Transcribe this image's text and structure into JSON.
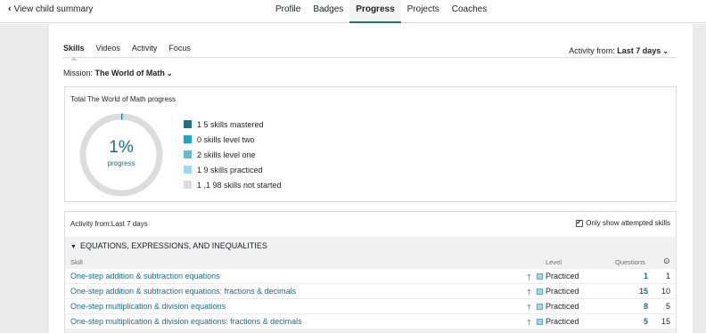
{
  "header": {
    "back_label": "View child summary",
    "tabs": [
      {
        "label": "Profile"
      },
      {
        "label": "Badges"
      },
      {
        "label": "Progress"
      },
      {
        "label": "Projects"
      },
      {
        "label": "Coaches"
      }
    ],
    "active_tab": "Progress"
  },
  "subtabs": {
    "items": [
      {
        "label": "Skills"
      },
      {
        "label": "Videos"
      },
      {
        "label": "Activity"
      },
      {
        "label": "Focus"
      }
    ],
    "active": "Skills",
    "activity_from_label": "Activity from:",
    "activity_from_value": "Last 7 days"
  },
  "mission": {
    "label": "Mission:",
    "value": "The World of Math"
  },
  "progress_card": {
    "title": "Total The World of Math progress",
    "percent_label": "1%",
    "progress_word": "progress",
    "percent_value": 0.01,
    "legend": [
      {
        "label": "1 5 skills mastered",
        "color": "#1c6f85"
      },
      {
        "label": "0 skills level two",
        "color": "#29a3c4"
      },
      {
        "label": "2 skills level one",
        "color": "#5ebcd6"
      },
      {
        "label": "1 9 skills practiced",
        "color": "#9fd8e6"
      },
      {
        "label": "1 ,1 98 skills not started",
        "color": "#dcdcdc"
      }
    ]
  },
  "activity_table": {
    "header": "Activity from:Last 7 days",
    "checkbox_label": "Only show attempted skills",
    "checkbox_checked": true,
    "section_title": "EQUATIONS, EXPRESSIONS, AND INEQUALITIES",
    "columns": {
      "skill": "Skill",
      "level": "Level",
      "questions": "Questions",
      "time_icon": "clock-icon"
    },
    "rows": [
      {
        "skill": "One-step addition & subtraction equations",
        "level": "Practiced",
        "questions": "1",
        "time": "1"
      },
      {
        "skill": "One-step addition & subtraction equations: fractions & decimals",
        "level": "Practiced",
        "questions": "15",
        "time": "10"
      },
      {
        "skill": "One-step multiplication & division equations",
        "level": "Practiced",
        "questions": "8",
        "time": "5"
      },
      {
        "skill": "One-step multiplication & division equations: fractions & decimals",
        "level": "Practiced",
        "questions": "5",
        "time": "15"
      }
    ]
  },
  "colors": {
    "accent_green": "#1e7b5a",
    "link_blue": "#1a6c8c",
    "practiced_swatch": "#9fd8e6",
    "page_gray": "#ebebeb"
  }
}
